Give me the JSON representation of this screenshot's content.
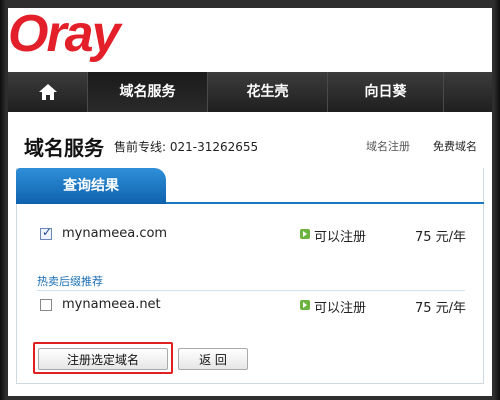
{
  "logo": {
    "text": "Oray"
  },
  "nav": {
    "home_icon": "home-icon",
    "items": [
      {
        "label": "域名服务"
      },
      {
        "label": "花生壳"
      },
      {
        "label": "向日葵"
      }
    ]
  },
  "header": {
    "title": "域名服务",
    "hotline_label": "售前专线:",
    "hotline_number": "021-31262655",
    "link_register": "域名注册",
    "link_free": "免费域名"
  },
  "panel": {
    "tab_label": "查询结果",
    "results": [
      {
        "domain": "mynameea.com",
        "status": "可以注册",
        "price": "75 元/年",
        "checked": true
      }
    ],
    "section_label": "热卖后缀推荐",
    "recommend": [
      {
        "domain": "mynameea.net",
        "status": "可以注册",
        "price": "75 元/年",
        "checked": false
      }
    ],
    "register_button": "注册选定域名",
    "back_button": "返 回"
  },
  "colors": {
    "brand_red": "#e3202a",
    "tab_blue": "#1a78c2",
    "status_green": "#6db33f",
    "highlight_red": "#e02020"
  }
}
